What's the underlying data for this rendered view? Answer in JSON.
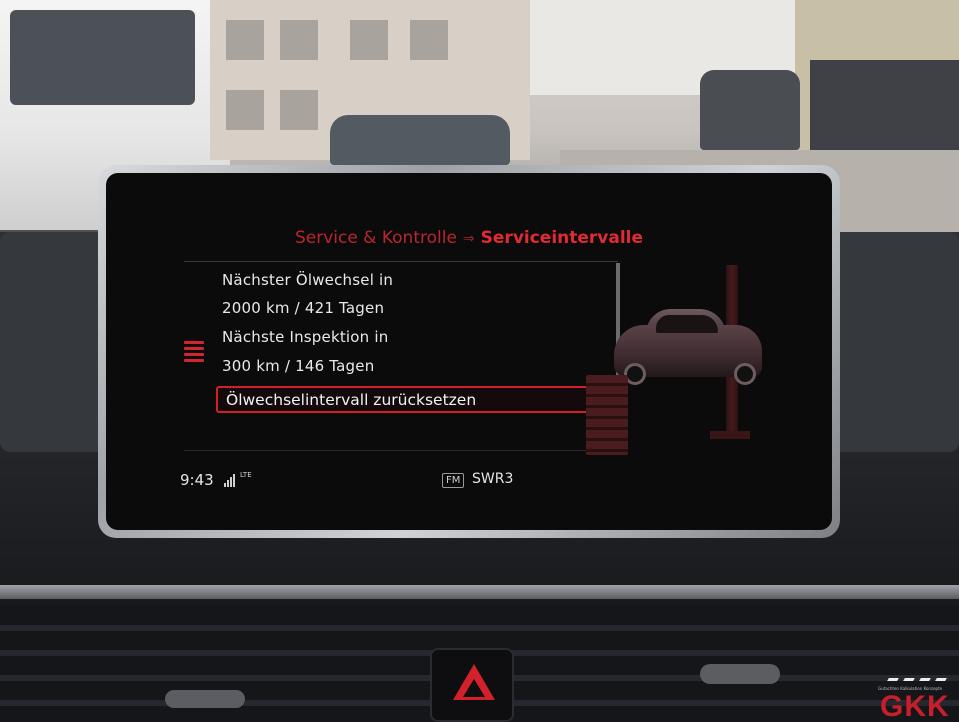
{
  "screen": {
    "breadcrumb": {
      "parent": "Service & Kontrolle",
      "separator": "⇒",
      "current": "Serviceintervalle"
    },
    "items": [
      {
        "label": "Nächster Ölwechsel in"
      },
      {
        "label": "2000 km / 421 Tagen"
      },
      {
        "label": "Nächste Inspektion in"
      },
      {
        "label": "300 km / 146 Tagen"
      }
    ],
    "selected_item": {
      "label": "Ölwechselintervall zurücksetzen"
    },
    "icons": [
      "car-on-lift-icon",
      "side-menu-indicator-icon",
      "signal-strength-icon"
    ],
    "colors": {
      "accent": "#d31f2a",
      "text": "#e9e9ea",
      "background": "#0b0b0c"
    }
  },
  "statusbar": {
    "time": "9:43",
    "network": "LTE",
    "band": "FM",
    "station": "SWR3"
  },
  "watermark": {
    "logo": "GKK",
    "tagline": "Gutachten Kalkulation Konzepte"
  }
}
